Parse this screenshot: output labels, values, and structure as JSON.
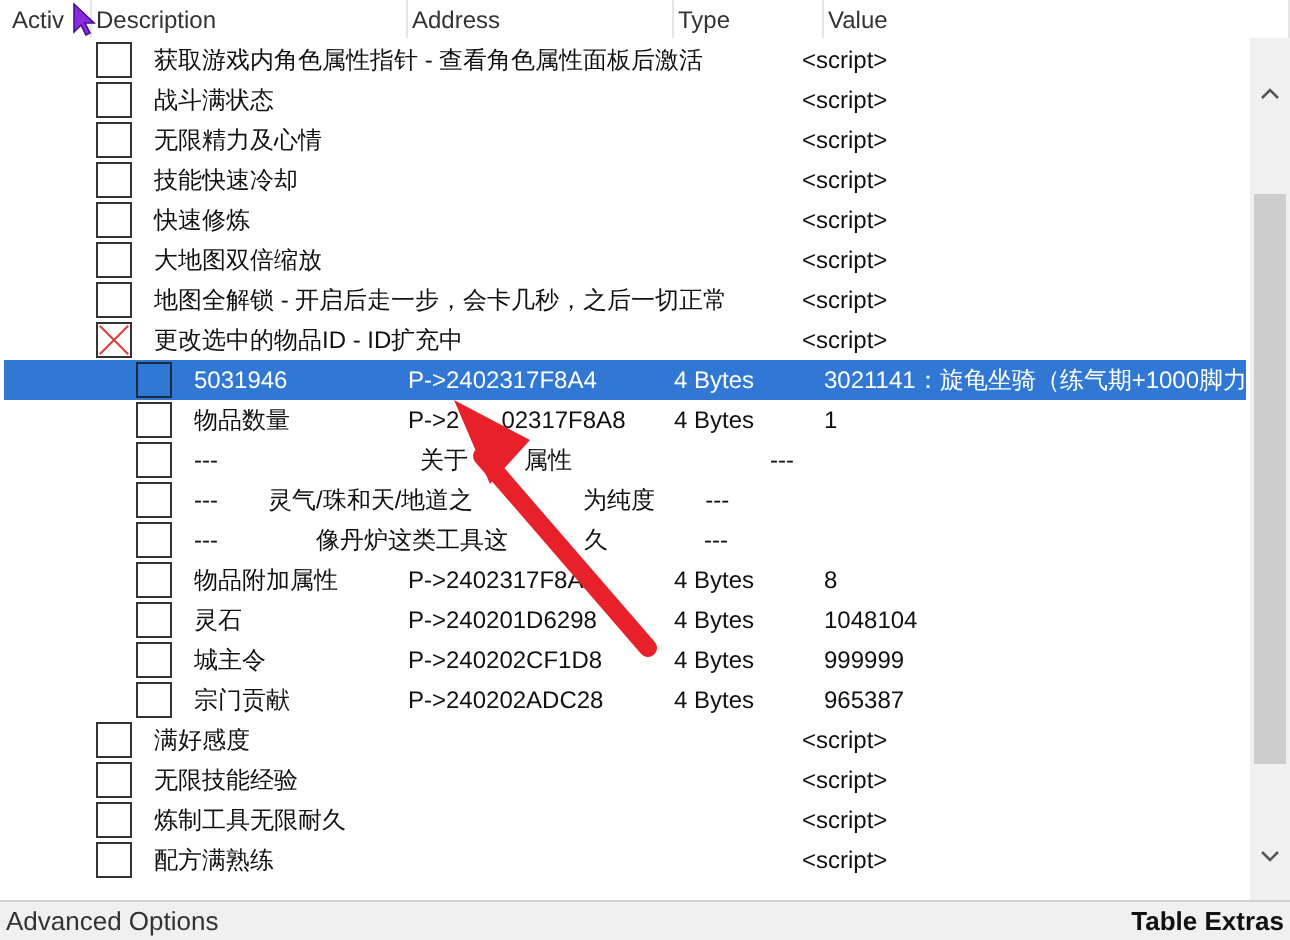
{
  "columns": [
    "Activ",
    "Description",
    "Address",
    "Type",
    "Value"
  ],
  "entries": [
    {
      "description": "获取游戏内角色属性指针 - 查看角色属性面板后激活",
      "value": "<script>",
      "checked": false,
      "selected": false
    },
    {
      "description": "战斗满状态",
      "value": "<script>",
      "checked": false,
      "selected": false
    },
    {
      "description": "无限精力及心情",
      "value": "<script>",
      "checked": false,
      "selected": false
    },
    {
      "description": "技能快速冷却",
      "value": "<script>",
      "checked": false,
      "selected": false
    },
    {
      "description": "快速修炼",
      "value": "<script>",
      "checked": false,
      "selected": false
    },
    {
      "description": "大地图双倍缩放",
      "value": "<script>",
      "checked": false,
      "selected": false
    },
    {
      "description": "地图全解锁 - 开启后走一步，会卡几秒，之后一切正常",
      "value": "<script>",
      "checked": false,
      "selected": false
    },
    {
      "description": "更改选中的物品ID - ID扩充中",
      "value": "<script>",
      "checked": true,
      "selected": false,
      "children": [
        {
          "kind": "value",
          "description": "5031946",
          "address": "P->2402317F8A4",
          "type": "4 Bytes",
          "value": "3021141：旋龟坐骑（练气期+1000脚力",
          "checked": false,
          "selected": true
        },
        {
          "kind": "value",
          "description": "物品数量",
          "address": [
            "P->2",
            "02317F8A8"
          ],
          "type": "4 Bytes",
          "value": "1",
          "checked": false,
          "selected": false
        },
        {
          "kind": "separator",
          "segments": [
            "---",
            "关于",
            "属性",
            "---"
          ],
          "checked": false,
          "selected": false
        },
        {
          "kind": "separator",
          "segments": [
            "---",
            "灵气/珠和天/地道之",
            "为纯度",
            "---"
          ],
          "checked": false,
          "selected": false
        },
        {
          "kind": "separator",
          "segments": [
            "---",
            "像丹炉这类工具这",
            "久",
            "---"
          ],
          "checked": false,
          "selected": false
        },
        {
          "kind": "value",
          "description": "物品附加属性",
          "address": "P->2402317F8A",
          "type": "4 Bytes",
          "value": "8",
          "checked": false,
          "selected": false
        },
        {
          "kind": "value",
          "description": "灵石",
          "address": "P->240201D6298",
          "type": "4 Bytes",
          "value": "1048104",
          "checked": false,
          "selected": false
        },
        {
          "kind": "value",
          "description": "城主令",
          "address": "P->240202CF1D8",
          "type": "4 Bytes",
          "value": "999999",
          "checked": false,
          "selected": false
        },
        {
          "kind": "value",
          "description": "宗门贡献",
          "address": "P->240202ADC28",
          "type": "4 Bytes",
          "value": "965387",
          "checked": false,
          "selected": false
        }
      ]
    },
    {
      "description": "满好感度",
      "value": "<script>",
      "checked": false,
      "selected": false
    },
    {
      "description": "无限技能经验",
      "value": "<script>",
      "checked": false,
      "selected": false
    },
    {
      "description": "炼制工具无限耐久",
      "value": "<script>",
      "checked": false,
      "selected": false
    },
    {
      "description": "配方满熟练",
      "value": "<script>",
      "checked": false,
      "selected": false
    }
  ],
  "footer": {
    "left": "Advanced Options",
    "right": "Table Extras"
  }
}
